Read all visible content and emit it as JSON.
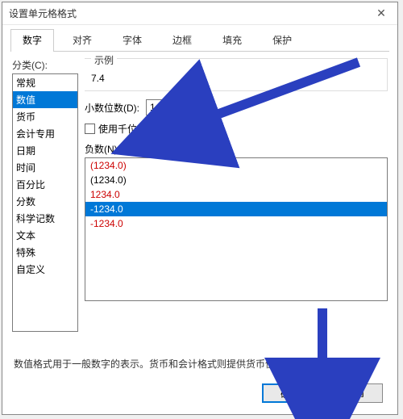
{
  "title": "设置单元格格式",
  "tabs": {
    "items": [
      "数字",
      "对齐",
      "字体",
      "边框",
      "填充",
      "保护"
    ],
    "active_index": 0
  },
  "category": {
    "label": "分类(C):",
    "items": [
      "常规",
      "数值",
      "货币",
      "会计专用",
      "日期",
      "时间",
      "百分比",
      "分数",
      "科学记数",
      "文本",
      "特殊",
      "自定义"
    ],
    "selected_index": 1
  },
  "example": {
    "label": "示例",
    "value": "7.4"
  },
  "decimals": {
    "label": "小数位数(D):",
    "value": "1"
  },
  "thousands": {
    "label": "使用千位分隔符(,)(U)",
    "checked": false
  },
  "negatives": {
    "label": "负数(N):",
    "items": [
      {
        "text": "(1234.0)",
        "color": "red"
      },
      {
        "text": "(1234.0)",
        "color": "black"
      },
      {
        "text": "1234.0",
        "color": "red"
      },
      {
        "text": "-1234.0",
        "color": "black"
      },
      {
        "text": "-1234.0",
        "color": "red"
      }
    ],
    "selected_index": 3
  },
  "description": "数值格式用于一般数字的表示。货币和会计格式则提供货币值计算的专用格式。",
  "buttons": {
    "ok": "确定",
    "cancel": "取消"
  },
  "arrow_color": "#2a3fbf"
}
